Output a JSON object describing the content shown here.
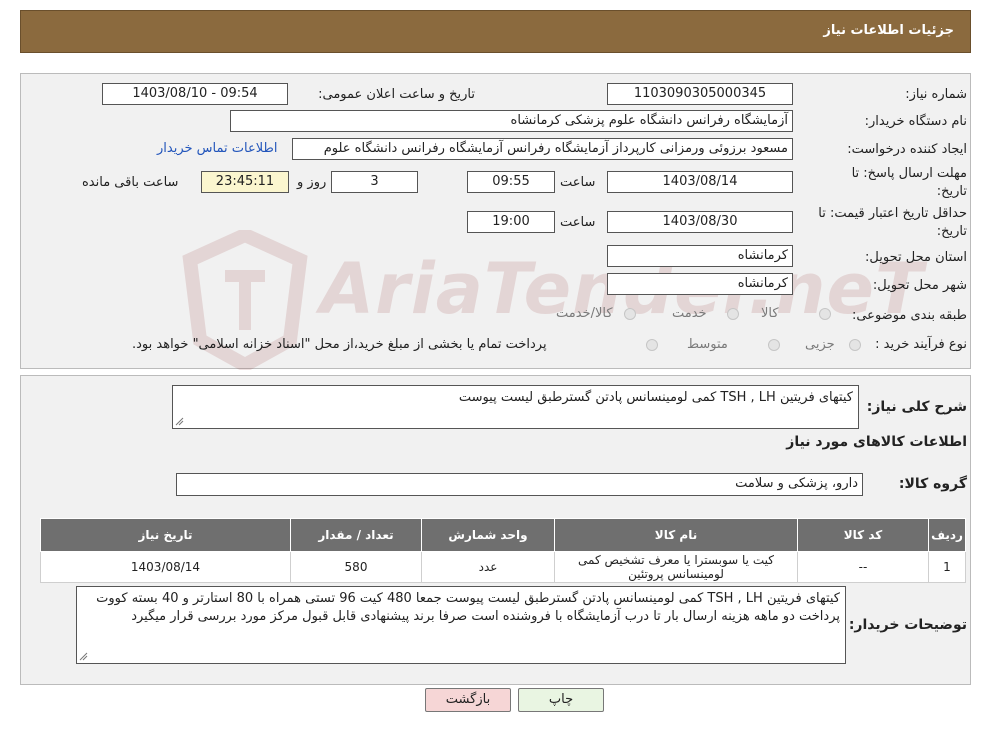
{
  "header": {
    "title": "جزئیات اطلاعات نیاز"
  },
  "fields": {
    "need_number": {
      "label": "شماره نیاز:",
      "value": "1103090305000345"
    },
    "announce": {
      "label": "تاریخ و ساعت اعلان عمومی:",
      "value": "1403/08/10 - 09:54"
    },
    "buyer_org": {
      "label": "نام دستگاه خریدار:",
      "value": "آزمایشگاه رفرانس دانشگاه علوم پزشکی کرمانشاه"
    },
    "creator": {
      "label": "ایجاد کننده درخواست:",
      "value": "مسعود برزوئی ورمزانی کارپرداز آزمایشگاه رفرانس آزمایشگاه رفرانس دانشگاه علوم",
      "contact_link": "اطلاعات تماس خریدار"
    },
    "deadline": {
      "label_line1": "مهلت ارسال پاسخ: تا",
      "label_line2": "تاریخ:",
      "date": "1403/08/14",
      "time_label": "ساعت",
      "time": "09:55",
      "days": "3",
      "days_label": "روز و",
      "remaining": "23:45:11",
      "remaining_label": "ساعت باقی مانده"
    },
    "validity": {
      "label_line1": "حداقل تاریخ اعتبار قیمت: تا",
      "label_line2": "تاریخ:",
      "date": "1403/08/30",
      "time_label": "ساعت",
      "time": "19:00"
    },
    "province": {
      "label": "استان محل تحویل:",
      "value": "کرمانشاه"
    },
    "city": {
      "label": "شهر محل تحویل:",
      "value": "کرمانشاه"
    },
    "category": {
      "label": "طبقه بندی موضوعی:",
      "options": [
        "کالا",
        "خدمت",
        "کالا/خدمت"
      ]
    },
    "process": {
      "label": "نوع فرآیند خرید :",
      "options": [
        "جزیی",
        "متوسط"
      ],
      "note": "پرداخت تمام یا بخشی از مبلغ خرید،از محل \"اسناد خزانه اسلامی\" خواهد بود."
    }
  },
  "summary": {
    "label": "شرح کلی نیاز:",
    "value": "کیتهای فریتین TSH , LH کمی لومینسانس پادتن گسترطبق لیست پیوست"
  },
  "goods_info": {
    "title": "اطلاعات کالاهای مورد نیاز"
  },
  "goods_group": {
    "label": "گروه کالا:",
    "value": "دارو، پزشکی و سلامت"
  },
  "table": {
    "headers": [
      "ردیف",
      "کد کالا",
      "نام کالا",
      "واحد شمارش",
      "تعداد / مقدار",
      "تاریخ نیاز"
    ],
    "rows": [
      [
        "1",
        "--",
        "کیت یا سوبسترا یا معرف تشخیص کمی لومینسانس پروتئین",
        "عدد",
        "580",
        "1403/08/14"
      ]
    ]
  },
  "buyer_notes": {
    "label": "توضیحات خریدار:",
    "value": "کیتهای فریتین TSH , LH کمی لومینسانس پادتن گسترطبق لیست پیوست جمعا 480 کیت 96 تستی همراه با 80 استارتر و 40 بسته کووت پرداخت دو ماهه هزینه ارسال بار تا درب آزمایشگاه با فروشنده است صرفا برند پیشنهادی قابل قبول مرکز مورد بررسی قرار میگیرد"
  },
  "buttons": {
    "print": "چاپ",
    "back": "بازگشت"
  },
  "watermark": {
    "text": "AriaTender.neT"
  },
  "colors": {
    "header": "#8b6a3e",
    "panel": "#f1f1f1",
    "table_header": "#6f6f6f",
    "link": "#2255bb"
  }
}
